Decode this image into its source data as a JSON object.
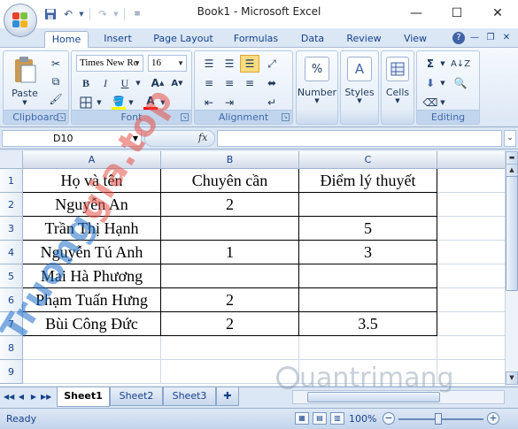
{
  "window": {
    "title": "Book1 - Microsoft Excel"
  },
  "tabs": [
    {
      "label": "Home"
    },
    {
      "label": "Insert"
    },
    {
      "label": "Page Layout"
    },
    {
      "label": "Formulas"
    },
    {
      "label": "Data"
    },
    {
      "label": "Review"
    },
    {
      "label": "View"
    }
  ],
  "ribbon": {
    "clipboard": {
      "label": "Clipboard",
      "paste": "Paste"
    },
    "font": {
      "label": "Font",
      "name": "Times New Rc",
      "size": "16",
      "bold": "B",
      "italic": "I",
      "underline": "U",
      "fill_color": "#ffff00",
      "font_color": "#ff0000"
    },
    "alignment": {
      "label": "Alignment"
    },
    "number": {
      "label": "Number",
      "symbol": "%"
    },
    "styles": {
      "label": "Styles"
    },
    "cells": {
      "label": "Cells"
    },
    "editing": {
      "label": "Editing"
    }
  },
  "formula_bar": {
    "name_box": "D10",
    "fx": "fx",
    "value": ""
  },
  "sheet": {
    "columns": [
      "A",
      "B",
      "C"
    ],
    "rows": [
      {
        "num": "1",
        "cells": [
          "Họ và tên",
          "Chuyên cần",
          "Điểm lý thuyết"
        ]
      },
      {
        "num": "2",
        "cells": [
          "Nguyễn An",
          "2",
          ""
        ]
      },
      {
        "num": "3",
        "cells": [
          "Trần Thị Hạnh",
          "",
          "5"
        ]
      },
      {
        "num": "4",
        "cells": [
          "Nguyễn Tú Anh",
          "1",
          "3"
        ]
      },
      {
        "num": "5",
        "cells": [
          "Mai Hà Phương",
          "",
          ""
        ]
      },
      {
        "num": "6",
        "cells": [
          "Phạm Tuấn Hưng",
          "2",
          ""
        ]
      },
      {
        "num": "7",
        "cells": [
          "Bùi Công Đức",
          "2",
          "3.5"
        ]
      },
      {
        "num": "8",
        "cells": [
          "",
          "",
          ""
        ]
      },
      {
        "num": "9",
        "cells": [
          "",
          "",
          ""
        ]
      }
    ]
  },
  "sheet_tabs": [
    {
      "label": "Sheet1"
    },
    {
      "label": "Sheet2"
    },
    {
      "label": "Sheet3"
    }
  ],
  "status": {
    "text": "Ready",
    "zoom": "100%",
    "zoom_minus": "−",
    "zoom_plus": "+"
  },
  "watermark": {
    "part1": "Truong",
    "part2": "gia.top",
    "bottom": "uantrimang"
  }
}
